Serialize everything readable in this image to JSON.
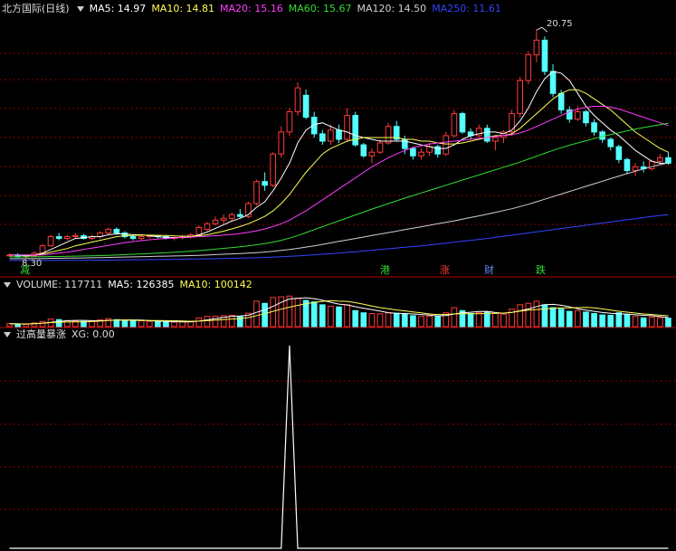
{
  "colors": {
    "up": "#ff3b3b",
    "down": "#54ffff",
    "ma5": "#ffffff",
    "ma10": "#ffff55",
    "ma20": "#ff3cff",
    "ma60": "#33dd33",
    "ma120": "#d0d0d0",
    "ma250": "#3344ff",
    "grid": "#8a0000",
    "bg": "#000000",
    "signal": "#ffffff"
  },
  "header": {
    "title": "北方国际(日线)",
    "ma5": "MA5: 14.97",
    "ma10": "MA10: 14.81",
    "ma20": "MA20: 15.16",
    "ma60": "MA60: 15.67",
    "ma120": "MA120: 14.50",
    "ma250": "MA250: 11.61"
  },
  "price_panel": {
    "high_label": "20.75",
    "low_label": "8.30"
  },
  "annotations": [
    {
      "text": "减",
      "color": "#33dd33"
    },
    {
      "text": "港",
      "color": "#33dd33"
    },
    {
      "text": "涨",
      "color": "#ff3b3b"
    },
    {
      "text": "财",
      "color": "#6688ff"
    },
    {
      "text": "跌",
      "color": "#33dd33"
    }
  ],
  "volume_header": {
    "title": "VOLUME: 117711",
    "ma5": "MA5: 126385",
    "ma10": "MA10: 100142"
  },
  "indicator_header": {
    "title": "过高量暴涨",
    "xg": "XG: 0.00"
  },
  "chart_data": [
    {
      "type": "candlestick",
      "ylim": [
        8.0,
        21.5
      ],
      "candles": [
        [
          8.5,
          8.6,
          8.4,
          8.5
        ],
        [
          8.5,
          8.6,
          8.35,
          8.4
        ],
        [
          8.4,
          8.5,
          8.3,
          8.45
        ],
        [
          8.45,
          8.7,
          8.4,
          8.6
        ],
        [
          8.6,
          9.1,
          8.55,
          9.0
        ],
        [
          9.0,
          9.6,
          8.95,
          9.5
        ],
        [
          9.5,
          9.7,
          9.3,
          9.4
        ],
        [
          9.4,
          9.6,
          9.3,
          9.5
        ],
        [
          9.5,
          9.7,
          9.4,
          9.55
        ],
        [
          9.55,
          9.65,
          9.35,
          9.4
        ],
        [
          9.4,
          9.6,
          9.3,
          9.5
        ],
        [
          9.5,
          9.8,
          9.4,
          9.7
        ],
        [
          9.7,
          10.0,
          9.6,
          9.9
        ],
        [
          9.9,
          10.0,
          9.6,
          9.7
        ],
        [
          9.7,
          9.8,
          9.4,
          9.5
        ],
        [
          9.5,
          9.6,
          9.3,
          9.4
        ],
        [
          9.4,
          9.6,
          9.3,
          9.5
        ],
        [
          9.5,
          9.6,
          9.4,
          9.55
        ],
        [
          9.55,
          9.6,
          9.4,
          9.5
        ],
        [
          9.5,
          9.6,
          9.35,
          9.4
        ],
        [
          9.4,
          9.5,
          9.3,
          9.45
        ],
        [
          9.45,
          9.6,
          9.35,
          9.5
        ],
        [
          9.5,
          9.7,
          9.4,
          9.6
        ],
        [
          9.6,
          10.1,
          9.55,
          10.0
        ],
        [
          9.9,
          10.3,
          9.8,
          10.2
        ],
        [
          10.2,
          10.6,
          10.1,
          10.4
        ],
        [
          10.4,
          10.7,
          10.2,
          10.5
        ],
        [
          10.5,
          10.8,
          10.3,
          10.7
        ],
        [
          10.7,
          11.0,
          10.5,
          10.6
        ],
        [
          10.6,
          11.4,
          10.5,
          11.3
        ],
        [
          11.3,
          12.6,
          11.2,
          12.5
        ],
        [
          12.5,
          13.0,
          12.0,
          12.3
        ],
        [
          12.3,
          14.1,
          12.2,
          14.0
        ],
        [
          14.0,
          15.5,
          13.8,
          15.2
        ],
        [
          15.2,
          16.5,
          15.0,
          16.3
        ],
        [
          16.3,
          17.9,
          16.1,
          17.6
        ],
        [
          17.2,
          17.5,
          15.9,
          16.0
        ],
        [
          16.0,
          16.3,
          14.9,
          15.1
        ],
        [
          15.1,
          15.3,
          14.5,
          14.7
        ],
        [
          14.7,
          15.6,
          14.5,
          15.3
        ],
        [
          15.3,
          15.6,
          14.6,
          14.8
        ],
        [
          14.8,
          16.5,
          14.7,
          16.1
        ],
        [
          16.1,
          16.3,
          14.4,
          14.5
        ],
        [
          14.5,
          14.6,
          13.8,
          13.9
        ],
        [
          13.9,
          14.3,
          13.5,
          14.1
        ],
        [
          14.1,
          14.8,
          14.0,
          14.6
        ],
        [
          14.6,
          15.7,
          14.5,
          15.5
        ],
        [
          15.5,
          15.8,
          14.7,
          14.8
        ],
        [
          14.8,
          15.0,
          14.0,
          14.3
        ],
        [
          14.3,
          14.4,
          13.7,
          13.9
        ],
        [
          13.9,
          14.3,
          13.7,
          14.1
        ],
        [
          14.1,
          14.6,
          13.9,
          14.4
        ],
        [
          14.4,
          14.5,
          13.8,
          14.0
        ],
        [
          14.0,
          15.2,
          13.9,
          15.0
        ],
        [
          15.0,
          16.4,
          14.9,
          16.2
        ],
        [
          16.2,
          16.3,
          15.1,
          15.2
        ],
        [
          15.2,
          15.4,
          14.8,
          15.0
        ],
        [
          15.0,
          15.6,
          14.9,
          15.4
        ],
        [
          15.4,
          15.6,
          14.6,
          14.7
        ],
        [
          14.7,
          15.0,
          14.2,
          14.9
        ],
        [
          14.9,
          15.3,
          14.6,
          15.2
        ],
        [
          15.2,
          16.4,
          15.0,
          16.2
        ],
        [
          16.2,
          18.2,
          16.0,
          18.0
        ],
        [
          18.0,
          19.6,
          17.8,
          19.4
        ],
        [
          19.4,
          20.75,
          19.0,
          20.2
        ],
        [
          20.2,
          20.4,
          18.3,
          18.5
        ],
        [
          18.5,
          18.9,
          17.1,
          17.3
        ],
        [
          17.3,
          17.5,
          16.2,
          16.4
        ],
        [
          16.4,
          16.6,
          15.7,
          15.9
        ],
        [
          15.9,
          16.6,
          15.8,
          16.3
        ],
        [
          16.3,
          16.4,
          15.5,
          15.7
        ],
        [
          15.7,
          15.9,
          15.0,
          15.2
        ],
        [
          15.2,
          15.3,
          14.6,
          14.8
        ],
        [
          14.8,
          14.9,
          14.2,
          14.4
        ],
        [
          14.4,
          14.5,
          13.5,
          13.7
        ],
        [
          13.7,
          13.8,
          12.9,
          13.1
        ],
        [
          13.1,
          13.5,
          12.8,
          13.3
        ],
        [
          13.3,
          13.6,
          13.0,
          13.2
        ],
        [
          13.2,
          13.7,
          13.1,
          13.6
        ],
        [
          13.6,
          14.0,
          13.4,
          13.8
        ],
        [
          13.8,
          14.1,
          13.4,
          13.5
        ]
      ],
      "ma_lines": [
        {
          "name": "MA5",
          "color": "#ffffff",
          "values": [
            8.5,
            8.5,
            8.45,
            8.5,
            8.6,
            8.8,
            9.0,
            9.2,
            9.4,
            9.45,
            9.5,
            9.5,
            9.6,
            9.65,
            9.65,
            9.6,
            9.6,
            9.55,
            9.5,
            9.47,
            9.45,
            9.45,
            9.48,
            9.6,
            9.75,
            9.95,
            10.15,
            10.35,
            10.5,
            10.7,
            11.1,
            11.4,
            12.0,
            12.7,
            13.5,
            14.6,
            15.3,
            15.6,
            15.7,
            15.5,
            15.3,
            15.2,
            15.0,
            14.9,
            14.8,
            14.7,
            14.7,
            14.7,
            14.7,
            14.6,
            14.5,
            14.4,
            14.3,
            14.3,
            14.5,
            14.8,
            15.0,
            15.1,
            15.2,
            15.2,
            15.1,
            15.3,
            15.8,
            16.5,
            17.4,
            18.1,
            18.5,
            18.4,
            18.0,
            17.3,
            16.6,
            16.1,
            15.7,
            15.3,
            15.0,
            14.6,
            14.2,
            13.9,
            13.6,
            13.5,
            13.5
          ]
        },
        {
          "name": "MA10",
          "color": "#ffff55",
          "values": [
            8.5,
            8.5,
            8.5,
            8.5,
            8.55,
            8.65,
            8.75,
            8.85,
            9.0,
            9.1,
            9.2,
            9.3,
            9.4,
            9.5,
            9.55,
            9.57,
            9.58,
            9.58,
            9.57,
            9.56,
            9.54,
            9.52,
            9.52,
            9.55,
            9.6,
            9.7,
            9.8,
            9.92,
            10.05,
            10.2,
            10.4,
            10.6,
            10.9,
            11.3,
            11.8,
            12.4,
            13.0,
            13.5,
            14.0,
            14.3,
            14.5,
            14.7,
            14.8,
            14.9,
            14.9,
            14.9,
            14.9,
            14.9,
            14.8,
            14.8,
            14.7,
            14.7,
            14.6,
            14.55,
            14.55,
            14.6,
            14.7,
            14.8,
            14.9,
            15.0,
            15.0,
            15.1,
            15.4,
            15.8,
            16.2,
            16.6,
            17.0,
            17.3,
            17.5,
            17.5,
            17.3,
            17.0,
            16.7,
            16.4,
            16.0,
            15.6,
            15.2,
            14.9,
            14.6,
            14.3,
            14.1
          ]
        },
        {
          "name": "MA20",
          "color": "#ff3cff",
          "values": [
            8.5,
            8.5,
            8.5,
            8.5,
            8.5,
            8.55,
            8.6,
            8.65,
            8.72,
            8.8,
            8.87,
            8.95,
            9.02,
            9.1,
            9.17,
            9.23,
            9.28,
            9.33,
            9.37,
            9.4,
            9.43,
            9.46,
            9.48,
            9.5,
            9.52,
            9.55,
            9.58,
            9.62,
            9.67,
            9.74,
            9.82,
            9.92,
            10.05,
            10.2,
            10.4,
            10.65,
            10.9,
            11.2,
            11.5,
            11.8,
            12.1,
            12.4,
            12.7,
            13.0,
            13.3,
            13.55,
            13.8,
            14.0,
            14.2,
            14.35,
            14.45,
            14.55,
            14.6,
            14.65,
            14.7,
            14.75,
            14.8,
            14.85,
            14.9,
            14.95,
            15.0,
            15.05,
            15.15,
            15.3,
            15.5,
            15.7,
            15.9,
            16.1,
            16.3,
            16.45,
            16.55,
            16.6,
            16.6,
            16.55,
            16.45,
            16.3,
            16.15,
            16.0,
            15.85,
            15.7,
            15.55
          ]
        },
        {
          "name": "MA60",
          "color": "#33dd33",
          "values": [
            8.4,
            8.4,
            8.4,
            8.41,
            8.41,
            8.42,
            8.42,
            8.43,
            8.44,
            8.45,
            8.46,
            8.47,
            8.48,
            8.5,
            8.52,
            8.54,
            8.56,
            8.58,
            8.6,
            8.62,
            8.65,
            8.68,
            8.71,
            8.74,
            8.78,
            8.82,
            8.86,
            8.9,
            8.95,
            9.0,
            9.06,
            9.12,
            9.2,
            9.3,
            9.42,
            9.56,
            9.72,
            9.88,
            10.04,
            10.2,
            10.36,
            10.52,
            10.68,
            10.84,
            11.0,
            11.15,
            11.3,
            11.45,
            11.6,
            11.74,
            11.88,
            12.02,
            12.16,
            12.3,
            12.44,
            12.58,
            12.72,
            12.86,
            13.0,
            13.14,
            13.28,
            13.42,
            13.56,
            13.72,
            13.88,
            14.04,
            14.2,
            14.34,
            14.48,
            14.6,
            14.72,
            14.84,
            14.96,
            15.06,
            15.16,
            15.26,
            15.36,
            15.44,
            15.52,
            15.6,
            15.67
          ]
        },
        {
          "name": "MA120",
          "color": "#d0d0d0",
          "values": [
            8.3,
            8.3,
            8.3,
            8.31,
            8.31,
            8.32,
            8.32,
            8.33,
            8.33,
            8.34,
            8.35,
            8.36,
            8.37,
            8.38,
            8.39,
            8.4,
            8.41,
            8.42,
            8.43,
            8.44,
            8.45,
            8.46,
            8.47,
            8.48,
            8.5,
            8.52,
            8.54,
            8.56,
            8.58,
            8.6,
            8.63,
            8.66,
            8.7,
            8.75,
            8.8,
            8.86,
            8.93,
            9.0,
            9.08,
            9.16,
            9.24,
            9.32,
            9.4,
            9.48,
            9.56,
            9.64,
            9.72,
            9.8,
            9.88,
            9.96,
            10.04,
            10.12,
            10.2,
            10.28,
            10.36,
            10.45,
            10.54,
            10.63,
            10.72,
            10.82,
            10.92,
            11.02,
            11.14,
            11.26,
            11.4,
            11.54,
            11.68,
            11.82,
            11.96,
            12.1,
            12.24,
            12.38,
            12.52,
            12.66,
            12.8,
            12.93,
            13.06,
            13.19,
            13.31,
            13.42,
            13.52
          ]
        },
        {
          "name": "MA250",
          "color": "#3344ff",
          "values": [
            8.2,
            8.2,
            8.2,
            8.2,
            8.2,
            8.2,
            8.21,
            8.21,
            8.21,
            8.21,
            8.22,
            8.22,
            8.22,
            8.23,
            8.23,
            8.24,
            8.24,
            8.25,
            8.25,
            8.26,
            8.26,
            8.27,
            8.28,
            8.28,
            8.29,
            8.3,
            8.31,
            8.32,
            8.33,
            8.34,
            8.35,
            8.37,
            8.39,
            8.41,
            8.43,
            8.45,
            8.48,
            8.51,
            8.54,
            8.57,
            8.6,
            8.64,
            8.68,
            8.72,
            8.76,
            8.8,
            8.84,
            8.88,
            8.92,
            8.96,
            9.0,
            9.05,
            9.1,
            9.15,
            9.2,
            9.25,
            9.3,
            9.35,
            9.4,
            9.46,
            9.52,
            9.58,
            9.64,
            9.7,
            9.76,
            9.82,
            9.88,
            9.94,
            10.0,
            10.06,
            10.12,
            10.18,
            10.24,
            10.3,
            10.36,
            10.42,
            10.48,
            10.54,
            10.6,
            10.65,
            10.7
          ]
        }
      ]
    },
    {
      "type": "bar",
      "title": "VOLUME",
      "ylim": [
        0,
        230000
      ],
      "values": [
        20000,
        18000,
        16000,
        25000,
        35000,
        52000,
        48000,
        42000,
        38000,
        36000,
        40000,
        46000,
        55000,
        48000,
        42000,
        38000,
        40000,
        36000,
        34000,
        32000,
        30000,
        33000,
        36000,
        60000,
        70000,
        72000,
        75000,
        78000,
        70000,
        92000,
        175000,
        160000,
        200000,
        205000,
        210000,
        195000,
        180000,
        170000,
        150000,
        140000,
        135000,
        150000,
        110000,
        95000,
        90000,
        88000,
        95000,
        92000,
        85000,
        75000,
        70000,
        72000,
        68000,
        95000,
        130000,
        110000,
        90000,
        95000,
        100000,
        90000,
        85000,
        120000,
        150000,
        160000,
        175000,
        150000,
        130000,
        120000,
        105000,
        110000,
        100000,
        90000,
        80000,
        78000,
        95000,
        85000,
        70000,
        60000,
        65000,
        62000,
        58000
      ],
      "ma_lines": [
        {
          "name": "MA5",
          "color": "#ffffff"
        },
        {
          "name": "MA10",
          "color": "#ffff55"
        }
      ]
    },
    {
      "type": "line",
      "title": "过高量暴涨",
      "ylim": [
        0,
        1
      ],
      "values": [
        0,
        0,
        0,
        0,
        0,
        0,
        0,
        0,
        0,
        0,
        0,
        0,
        0,
        0,
        0,
        0,
        0,
        0,
        0,
        0,
        0,
        0,
        0,
        0,
        0,
        0,
        0,
        0,
        0,
        0,
        0,
        0,
        0,
        0,
        1,
        0,
        0,
        0,
        0,
        0,
        0,
        0,
        0,
        0,
        0,
        0,
        0,
        0,
        0,
        0,
        0,
        0,
        0,
        0,
        0,
        0,
        0,
        0,
        0,
        0,
        0,
        0,
        0,
        0,
        0,
        0,
        0,
        0,
        0,
        0,
        0,
        0,
        0,
        0,
        0,
        0,
        0,
        0,
        0,
        0,
        0
      ]
    }
  ]
}
